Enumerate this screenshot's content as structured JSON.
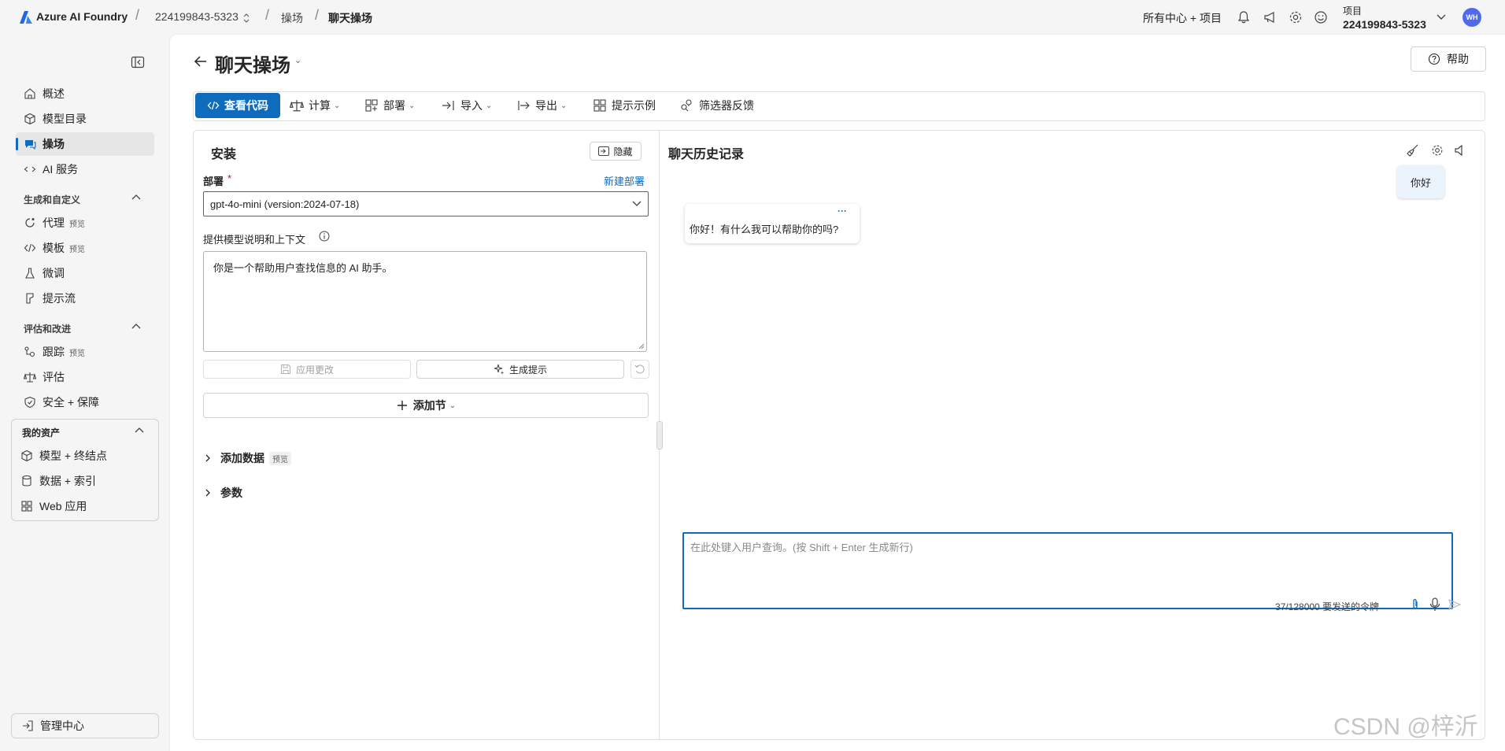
{
  "topbar": {
    "brand": "Azure AI Foundry",
    "project_id": "224199843-5323",
    "crumb_playground": "操场",
    "crumb_current": "聊天操场",
    "all_hub": "所有中心 + 项目",
    "project_label": "项目",
    "project_name": "224199843-5323",
    "avatar": "WH"
  },
  "sidebar": {
    "items_top": [
      {
        "label": "概述",
        "icon": "home-icon"
      },
      {
        "label": "模型目录",
        "icon": "cube-icon"
      },
      {
        "label": "操场",
        "icon": "chat-icon",
        "active": true
      },
      {
        "label": "AI 服务",
        "icon": "link-icon"
      }
    ],
    "section_build": "生成和自定义",
    "items_build": [
      {
        "label": "代理",
        "badge": "预览",
        "icon": "agent-icon"
      },
      {
        "label": "模板",
        "badge": "预览",
        "icon": "code-icon"
      },
      {
        "label": "微调",
        "icon": "flask-icon"
      },
      {
        "label": "提示流",
        "icon": "flow-icon"
      }
    ],
    "section_eval": "评估和改进",
    "items_eval": [
      {
        "label": "跟踪",
        "badge": "预览",
        "icon": "trace-icon"
      },
      {
        "label": "评估",
        "icon": "scale-icon"
      },
      {
        "label": "安全 + 保障",
        "icon": "shield-icon"
      }
    ],
    "section_assets": "我的资产",
    "items_assets": [
      {
        "label": "模型 + 终结点",
        "icon": "cube-icon"
      },
      {
        "label": "数据 + 索引",
        "icon": "database-icon"
      },
      {
        "label": "Web 应用",
        "icon": "apps-icon"
      }
    ],
    "management": "管理中心"
  },
  "page": {
    "title": "聊天操场",
    "help": "帮助"
  },
  "toolbar": {
    "view_code": "查看代码",
    "compute": "计算",
    "deploy": "部署",
    "import": "导入",
    "export": "导出",
    "prompt_samples": "提示示例",
    "filter_feedback": "筛选器反馈"
  },
  "setup": {
    "title": "安装",
    "hide": "隐藏",
    "deployment_label": "部署",
    "required_mark": "*",
    "new_deployment": "新建部署",
    "deployment_value": "gpt-4o-mini (version:2024-07-18)",
    "instructions_label": "提供模型说明和上下文",
    "instructions_value": "你是一个帮助用户查找信息的 AI 助手。",
    "apply_changes": "应用更改",
    "generate_prompt": "生成提示",
    "add_section": "添加节",
    "add_data": "添加数据",
    "add_data_badge": "预览",
    "parameters": "参数"
  },
  "chat": {
    "title": "聊天历史记录",
    "user_message": "你好",
    "assistant_more": "···",
    "assistant_message": "你好！有什么我可以帮助你的吗?",
    "input_placeholder": "在此处键入用户查询。(按 Shift + Enter 生成新行)",
    "token_count": "37/128000 要发送的令牌"
  },
  "watermark": "CSDN @梓沂",
  "colors": {
    "accent": "#0f6cbd",
    "brand": "#2266e3"
  }
}
